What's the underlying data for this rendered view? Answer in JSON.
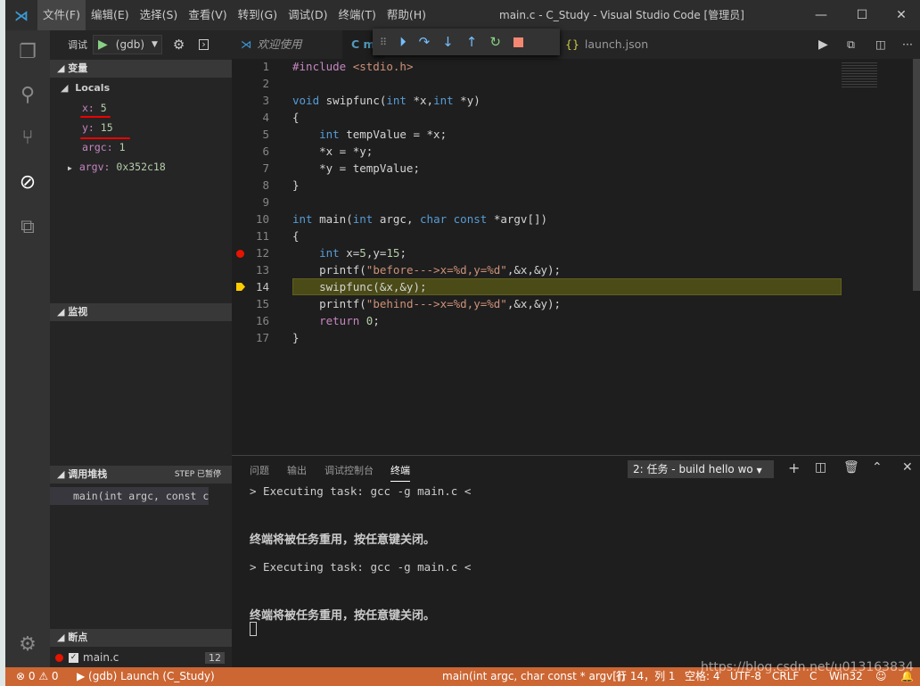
{
  "title": "main.c - C_Study - Visual Studio Code [管理员]",
  "menu": [
    "文件(F)",
    "编辑(E)",
    "选择(S)",
    "查看(V)",
    "转到(G)",
    "调试(D)",
    "终端(T)",
    "帮助(H)"
  ],
  "debug": {
    "label": "调试",
    "config": "(gdb)"
  },
  "variables": {
    "header": "变量",
    "scope": "Locals",
    "items": [
      {
        "name": "x:",
        "value": "5"
      },
      {
        "name": "y:",
        "value": "15"
      },
      {
        "name": "argc:",
        "value": "1"
      },
      {
        "name": "argv:",
        "value": "0x352c18"
      }
    ]
  },
  "watch": {
    "header": "监视"
  },
  "callstack": {
    "header": "调用堆栈",
    "status": "STEP 已暂停",
    "frame": "main(int argc, const char"
  },
  "breakpoints": {
    "header": "断点",
    "file": "main.c",
    "line": "12"
  },
  "tabs": {
    "welcome": "欢迎使用",
    "main": "C m",
    "launch": "launch.json"
  },
  "code": [
    [
      [
        "#include ",
        "pp"
      ],
      [
        "<stdio.h>",
        "st"
      ]
    ],
    [],
    [
      [
        "void ",
        "kw"
      ],
      [
        "swipfunc(",
        ""
      ],
      [
        "int ",
        "kw"
      ],
      [
        "*x,",
        ""
      ],
      [
        "int ",
        "kw"
      ],
      [
        "*y)",
        ""
      ]
    ],
    [
      [
        "{",
        ""
      ]
    ],
    [
      [
        "    ",
        ""
      ],
      [
        "int ",
        "kw"
      ],
      [
        "tempValue = *x;",
        ""
      ]
    ],
    [
      [
        "    *x = *y;",
        ""
      ]
    ],
    [
      [
        "    *y = tempValue;",
        ""
      ]
    ],
    [
      [
        "}",
        ""
      ]
    ],
    [],
    [
      [
        "int ",
        "kw"
      ],
      [
        "main(",
        ""
      ],
      [
        "int ",
        "kw"
      ],
      [
        "argc, ",
        ""
      ],
      [
        "char const ",
        "kw"
      ],
      [
        "*argv[])",
        ""
      ]
    ],
    [
      [
        "{",
        ""
      ]
    ],
    [
      [
        "    ",
        ""
      ],
      [
        "int ",
        "kw"
      ],
      [
        "x=",
        ""
      ],
      [
        "5",
        "nu"
      ],
      [
        ",y=",
        ""
      ],
      [
        "15",
        "nu"
      ],
      [
        ";",
        ""
      ]
    ],
    [
      [
        "    printf(",
        ""
      ],
      [
        "\"before--->x=%d,y=%d\"",
        "st"
      ],
      [
        ",&x,&y);",
        ""
      ]
    ],
    [
      [
        "    swipfunc(&x,&y);",
        ""
      ]
    ],
    [
      [
        "    printf(",
        ""
      ],
      [
        "\"behind--->x=%d,y=%d\"",
        "st"
      ],
      [
        ",&x,&y);",
        ""
      ]
    ],
    [
      [
        "    ",
        ""
      ],
      [
        "return ",
        "pp"
      ],
      [
        "0",
        "nu"
      ],
      [
        ";",
        ""
      ]
    ],
    [
      [
        "}",
        ""
      ]
    ]
  ],
  "breakpoint_line": 12,
  "current_line": 14,
  "panel": {
    "tabs": [
      "问题",
      "输出",
      "调试控制台",
      "终端"
    ],
    "active": "终端",
    "terminal_select": "2: 任务 - build hello wo",
    "lines": [
      "> Executing task: gcc -g main.c <",
      "终端将被任务重用，按任意键关闭。",
      "> Executing task: gcc -g main.c <",
      "终端将被任务重用，按任意键关闭。"
    ]
  },
  "status": {
    "errors": "0",
    "warnings": "0",
    "launch": "(gdb) Launch (C_Study)",
    "frame": "main(int argc, char const * argv[])",
    "position": "行 14，列 1",
    "spaces": "空格: 4",
    "encoding": "UTF-8",
    "eol": "CRLF",
    "language": "C",
    "platform": "Win32",
    "watermark": "https://blog.csdn.net/u013163834"
  },
  "colors": {
    "status": "#cc6633",
    "accent": "#3c99d4"
  }
}
